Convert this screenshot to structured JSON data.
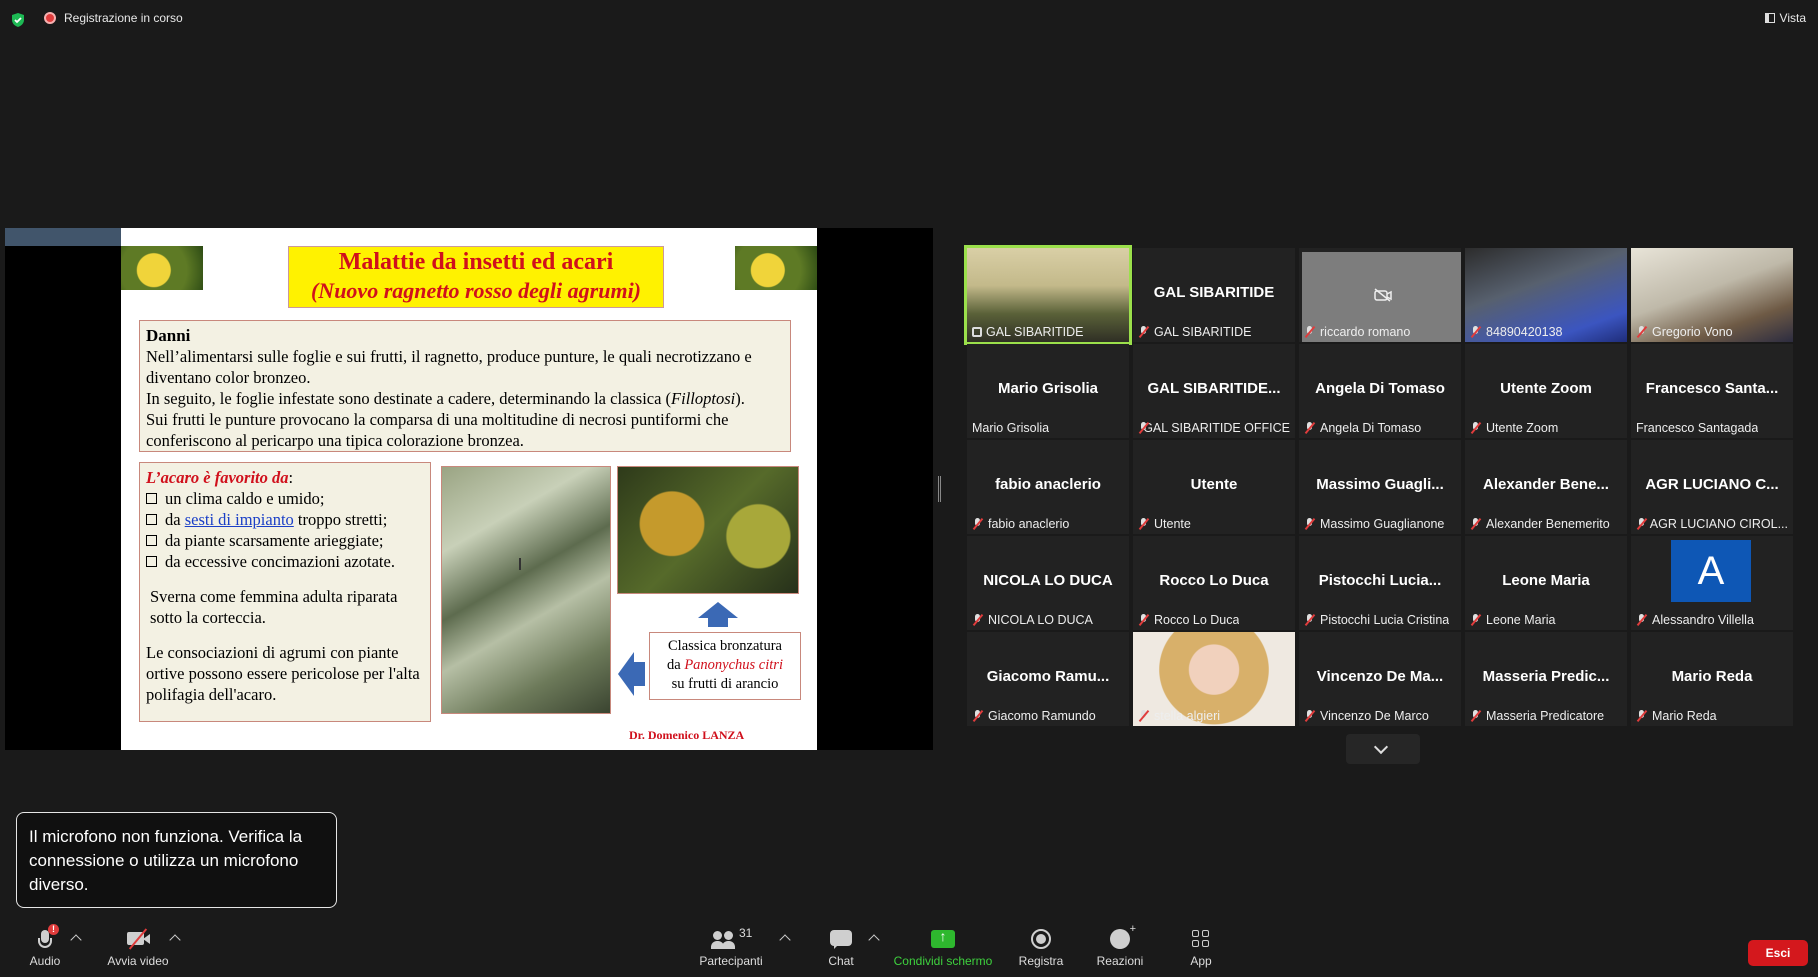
{
  "topbar": {
    "recording_label": "Registrazione in corso",
    "view_label": "Vista"
  },
  "slide": {
    "title_line1": "Malattie da insetti ed acari",
    "title_line2": "(Nuovo ragnetto rosso degli agrumi)",
    "danni_heading": "Danni",
    "danni_p1": "Nell’alimentarsi sulle foglie e sui frutti, il ragnetto, produce punture, le quali necrotizzano e diventano color bronzeo.",
    "danni_p2_prefix": "In seguito, le foglie infestate sono destinate a cadere, determinando la classica (",
    "danni_p2_term": "Filloptosi",
    "danni_p2_suffix": ").",
    "danni_p3": "Sui frutti le punture provocano la comparsa di una moltitudine di necrosi puntiformi che conferiscono al pericarpo una tipica colorazione bronzea.",
    "acaro_heading": "L’acaro è favorito da",
    "acaro_heading_colon": ":",
    "bullet1": "un clima caldo e umido;",
    "bullet2_prefix": "da ",
    "bullet2_link": "sesti di impianto",
    "bullet2_suffix": " troppo stretti;",
    "bullet3": "da piante scarsamente arieggiate;",
    "bullet4": "da eccessive concimazioni azotate.",
    "sverna": "Sverna come femmina adulta riparata sotto la corteccia.",
    "consociazioni": "Le consociazioni di agrumi con piante ortive possono essere pericolose per l'alta polifagia dell'acaro.",
    "caption_line1": "Classica bronzatura",
    "caption_line2_prefix": "da ",
    "caption_line2_species": "Panonychus citri",
    "caption_line3": "su frutti di arancio",
    "author": "Dr. Domenico LANZA"
  },
  "gallery": {
    "tiles": [
      {
        "name": "",
        "label": "GAL SIBARITIDE",
        "video": "vid-a",
        "active": true,
        "pinned": true
      },
      {
        "name": "GAL SIBARITIDE",
        "label": "GAL SIBARITIDE",
        "muted": true
      },
      {
        "name": "",
        "label": "riccardo romano",
        "camoff": true,
        "muted": true
      },
      {
        "name": "",
        "label": "84890420138",
        "video": "vid-b",
        "muted": true
      },
      {
        "name": "",
        "label": "Gregorio Vono",
        "video": "vid-c",
        "muted": true
      },
      {
        "name": "Mario Grisolia",
        "label": "Mario Grisolia"
      },
      {
        "name": "GAL SIBARITIDE...",
        "label": "GAL SIBARITIDE OFFICE",
        "muted": true
      },
      {
        "name": "Angela Di Tomaso",
        "label": "Angela Di Tomaso",
        "muted": true
      },
      {
        "name": "Utente Zoom",
        "label": "Utente Zoom",
        "muted": true
      },
      {
        "name": "Francesco Santa...",
        "label": "Francesco Santagada"
      },
      {
        "name": "fabio anaclerio",
        "label": "fabio anaclerio",
        "muted": true
      },
      {
        "name": "Utente",
        "label": "Utente",
        "muted": true
      },
      {
        "name": "Massimo Guagli...",
        "label": "Massimo Guaglianone",
        "muted": true
      },
      {
        "name": "Alexander Bene...",
        "label": "Alexander Benemerito",
        "muted": true
      },
      {
        "name": "AGR LUCIANO C...",
        "label": "AGR LUCIANO CIROL...",
        "muted": true
      },
      {
        "name": "NICOLA LO DUCA",
        "label": "NICOLA LO DUCA",
        "muted": true
      },
      {
        "name": "Rocco Lo Duca",
        "label": "Rocco Lo Duca",
        "muted": true
      },
      {
        "name": "Pistocchi Lucia...",
        "label": "Pistocchi Lucia Cristina",
        "muted": true
      },
      {
        "name": "Leone Maria",
        "label": "Leone Maria",
        "muted": true
      },
      {
        "name": "",
        "label": "Alessandro Villella",
        "avatar": "A",
        "muted": true
      },
      {
        "name": "Giacomo Ramu...",
        "label": "Giacomo Ramundo",
        "muted": true
      },
      {
        "name": "",
        "label": "stella algieri",
        "video": "vid-d",
        "muted": true
      },
      {
        "name": "Vincenzo De Ma...",
        "label": "Vincenzo De Marco",
        "muted": true
      },
      {
        "name": "Masseria Predic...",
        "label": "Masseria Predicatore",
        "muted": true
      },
      {
        "name": "Mario Reda",
        "label": "Mario Reda",
        "muted": true
      }
    ]
  },
  "toast": {
    "message": "Il microfono non funziona. Verifica la connessione o utilizza un microfono diverso."
  },
  "toolbar": {
    "audio_label": "Audio",
    "audio_badge": "!",
    "video_label": "Avvia video",
    "participants_label": "Partecipanti",
    "participants_count": "31",
    "chat_label": "Chat",
    "share_label": "Condividi schermo",
    "record_label": "Registra",
    "reactions_label": "Reazioni",
    "apps_label": "App",
    "leave_label": "Esci"
  },
  "colors": {
    "active_speaker": "#9be04b",
    "share_green": "#2eb82e",
    "leave_red": "#d4181d",
    "slide_title_red": "#d0101c",
    "slide_title_bg": "#fff200"
  }
}
